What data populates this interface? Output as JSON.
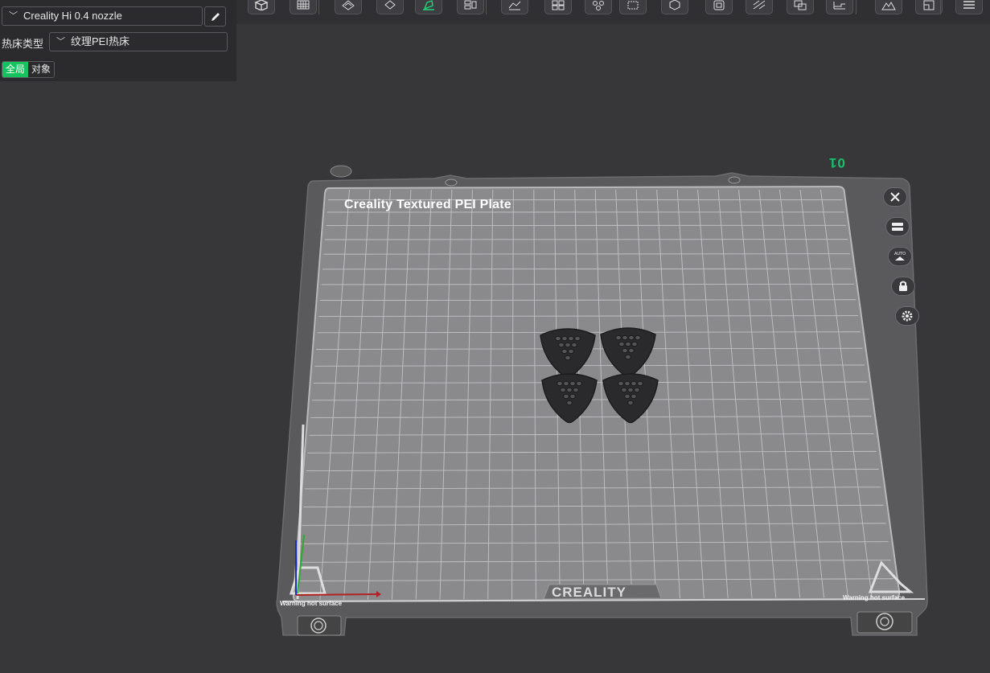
{
  "left_panel": {
    "nozzle_combo": {
      "value": "Creality Hi 0.4 nozzle",
      "icon": "chevron-down-icon"
    },
    "edit_icon": "pencil-icon",
    "bed_type_label": "热床类型",
    "bed_type_combo": {
      "value": "纹理PEI热床",
      "icon": "chevron-down-icon"
    },
    "scope_toggle": {
      "global": "全局",
      "object": "对象",
      "selected": "全局"
    }
  },
  "toolbar": {
    "buttons": [
      "cube-icon",
      "grid-icon",
      "support-paint-icon",
      "tag-icon",
      "seam-paint-icon",
      "arrange-icon",
      "layers-icon",
      "split-icon",
      "settings-group-icon",
      "scale-icon",
      "view-3d-icon",
      "cut-icon",
      "slope-icon",
      "boolean-icon",
      "measure-icon",
      "terrain-icon",
      "assembly-icon",
      "menu-icon"
    ],
    "active_index": 4
  },
  "scene": {
    "plate_title": "Creality Textured PEI Plate",
    "plate_number": "01",
    "warning_left": "Warning hot surface",
    "warning_right": "Warning hot surface",
    "brand": "CREALITY",
    "object_count": 4,
    "accent_color": "#19c06a",
    "right_buttons": [
      "close-icon",
      "list-icon",
      "auto-orient-icon",
      "lock-icon",
      "gear-icon"
    ]
  }
}
